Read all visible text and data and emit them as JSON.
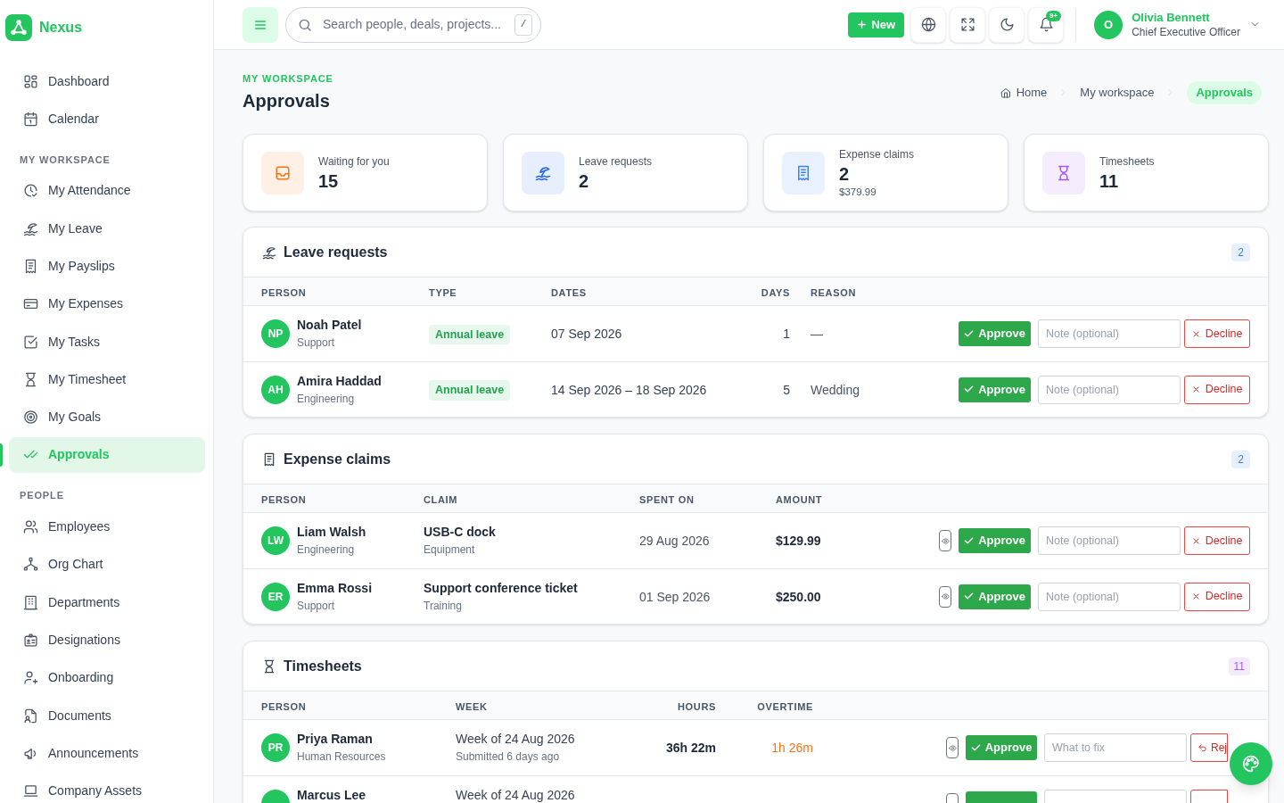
{
  "sidebar": {
    "brand": "Nexus",
    "sections": [
      {
        "items": [
          {
            "label": "Dashboard",
            "selected": false
          },
          {
            "label": "Calendar",
            "selected": false
          }
        ]
      },
      {
        "title": "MY WORKSPACE",
        "items": [
          {
            "label": "My Attendance",
            "selected": false
          },
          {
            "label": "My Leave",
            "selected": false
          },
          {
            "label": "My Payslips",
            "selected": false
          },
          {
            "label": "My Expenses",
            "selected": false
          },
          {
            "label": "My Tasks",
            "selected": false
          },
          {
            "label": "My Timesheet",
            "selected": false
          },
          {
            "label": "My Goals",
            "selected": false
          },
          {
            "label": "Approvals",
            "selected": true
          }
        ]
      },
      {
        "title": "PEOPLE",
        "items": [
          {
            "label": "Employees",
            "selected": false
          },
          {
            "label": "Org Chart",
            "selected": false
          },
          {
            "label": "Departments",
            "selected": false
          },
          {
            "label": "Designations",
            "selected": false
          },
          {
            "label": "Onboarding",
            "selected": false
          },
          {
            "label": "Documents",
            "selected": false
          },
          {
            "label": "Announcements",
            "selected": false
          },
          {
            "label": "Company Assets",
            "selected": false
          }
        ]
      }
    ]
  },
  "header": {
    "search": {
      "placeholder": "Search people, deals, projects...",
      "shortcut": "/"
    },
    "new_label": "New",
    "notification_count": "9+",
    "user": {
      "initials": "O",
      "name": "Olivia Bennett",
      "role": "Chief Executive Officer"
    }
  },
  "page": {
    "eyebrow": "MY WORKSPACE",
    "title": "Approvals",
    "breadcrumb": [
      {
        "label": "Home",
        "selected": false
      },
      {
        "label": "My workspace",
        "selected": false
      },
      {
        "label": "Approvals",
        "selected": true
      }
    ]
  },
  "stats": [
    {
      "label": "Waiting for you",
      "value": "15",
      "color": "#f97316"
    },
    {
      "label": "Leave requests",
      "value": "2",
      "color": "#2563eb"
    },
    {
      "label": "Expense claims",
      "value": "2",
      "sub": "$379.99",
      "color": "#3b82f6"
    },
    {
      "label": "Timesheets",
      "value": "11",
      "color": "#a855f7"
    }
  ],
  "sections": [
    {
      "kind": "leave",
      "title": "Leave requests",
      "count": "2",
      "color": "#3b82f6",
      "columns": [
        "PERSON",
        "TYPE",
        "DATES",
        "DAYS",
        "REASON"
      ],
      "rows": [
        {
          "initials": "NP",
          "name": "Noah Patel",
          "department": "Support",
          "type": "Annual leave",
          "dates": "07 Sep 2026",
          "days": "1",
          "reason": "—",
          "actions": {
            "approve": "Approve",
            "note_placeholder": "Note (optional)",
            "decline": "Decline"
          }
        },
        {
          "initials": "AH",
          "name": "Amira Haddad",
          "department": "Engineering",
          "type": "Annual leave",
          "dates": "14 Sep 2026 – 18 Sep 2026",
          "days": "5",
          "reason": "Wedding",
          "actions": {
            "approve": "Approve",
            "note_placeholder": "Note (optional)",
            "decline": "Decline"
          }
        }
      ]
    },
    {
      "kind": "expense",
      "title": "Expense claims",
      "count": "2",
      "color": "#3b82f6",
      "columns": [
        "PERSON",
        "CLAIM",
        "SPENT ON",
        "AMOUNT"
      ],
      "rows": [
        {
          "initials": "LW",
          "name": "Liam Walsh",
          "department": "Engineering",
          "claim": "USB-C dock",
          "category": "Equipment",
          "spent_on": "29 Aug 2026",
          "amount": "$129.99",
          "actions": {
            "approve": "Approve",
            "note_placeholder": "Note (optional)",
            "decline": "Decline"
          }
        },
        {
          "initials": "ER",
          "name": "Emma Rossi",
          "department": "Support",
          "claim": "Support conference ticket",
          "category": "Training",
          "spent_on": "01 Sep 2026",
          "amount": "$250.00",
          "actions": {
            "approve": "Approve",
            "note_placeholder": "Note (optional)",
            "decline": "Decline"
          }
        }
      ]
    },
    {
      "kind": "timesheet",
      "title": "Timesheets",
      "count": "11",
      "color": "#a855f7",
      "columns": [
        "PERSON",
        "WEEK",
        "HOURS",
        "OVERTIME"
      ],
      "rows": [
        {
          "initials": "PR",
          "name": "Priya Raman",
          "department": "Human Resources",
          "week": "Week of 24 Aug 2026",
          "submitted": "Submitted 6 days ago",
          "hours": "36h 22m",
          "overtime": "1h 26m",
          "actions": {
            "approve": "Approve",
            "note_placeholder": "What to fix",
            "reject": "Rej"
          }
        },
        {
          "name": "Marcus Lee",
          "week": "Week of 24 Aug 2026"
        }
      ]
    }
  ]
}
